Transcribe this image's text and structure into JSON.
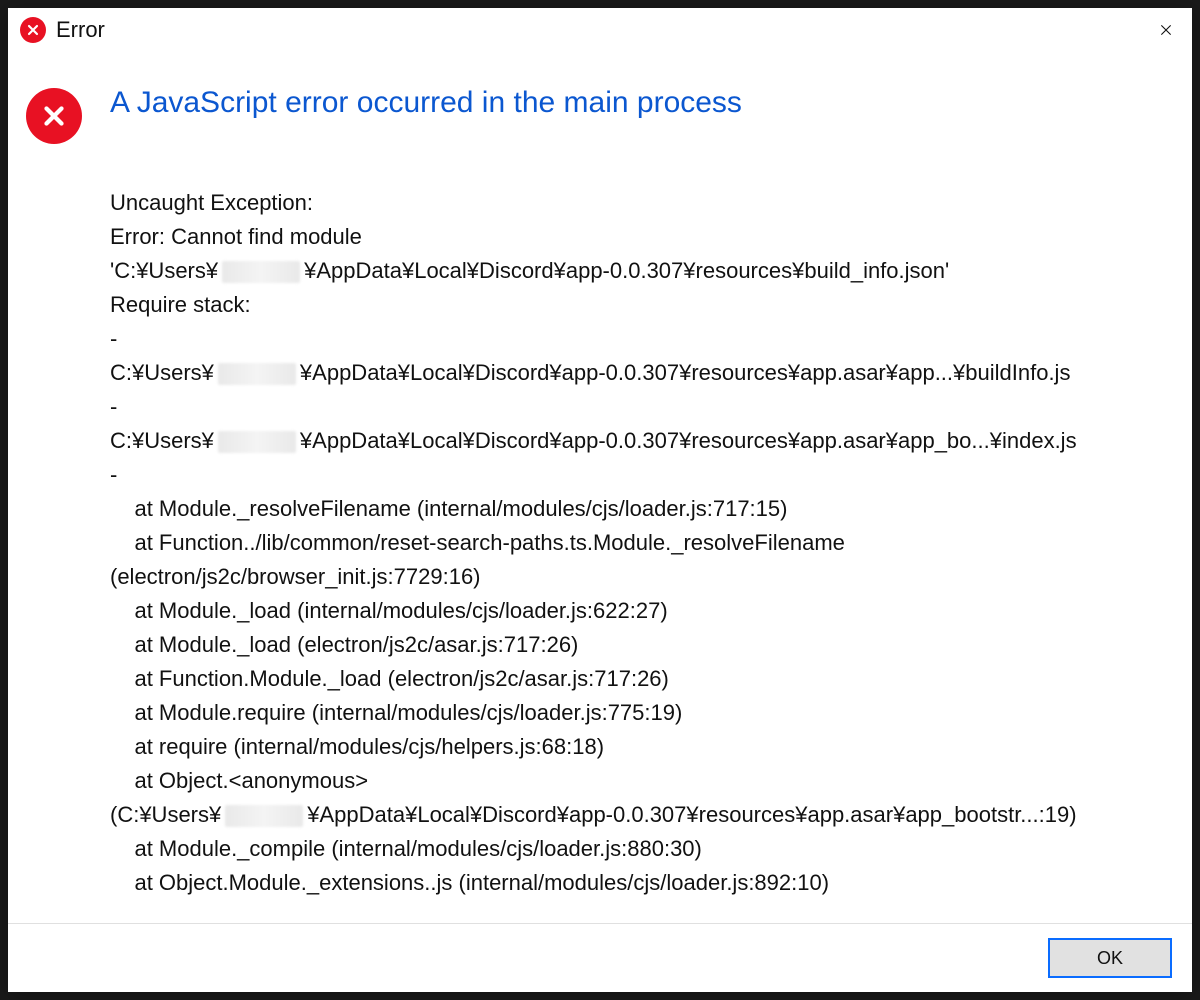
{
  "title": "Error",
  "close_label": "Close",
  "heading": "A JavaScript error occurred in the main process",
  "redacted": "[redacted]",
  "msg": {
    "l1": "Uncaught Exception:",
    "l2": "Error: Cannot find module",
    "l3a": "'C:¥Users¥",
    "l3b": "¥AppData¥Local¥Discord¥app-0.0.307¥resources¥build_info.json'",
    "l4": "Require stack:",
    "l5": "-",
    "l6a": "C:¥Users¥",
    "l6b": "¥AppData¥Local¥Discord¥app-0.0.307¥resources¥app.asar¥app...¥buildInfo.js",
    "l7": "-",
    "l8a": "C:¥Users¥",
    "l8b": "¥AppData¥Local¥Discord¥app-0.0.307¥resources¥app.asar¥app_bo...¥index.js",
    "l9": "-",
    "l10": "    at Module._resolveFilename (internal/modules/cjs/loader.js:717:15)",
    "l11": "    at Function../lib/common/reset-search-paths.ts.Module._resolveFilename",
    "l12": "(electron/js2c/browser_init.js:7729:16)",
    "l13": "    at Module._load (internal/modules/cjs/loader.js:622:27)",
    "l14": "    at Module._load (electron/js2c/asar.js:717:26)",
    "l15": "    at Function.Module._load (electron/js2c/asar.js:717:26)",
    "l16": "    at Module.require (internal/modules/cjs/loader.js:775:19)",
    "l17": "    at require (internal/modules/cjs/helpers.js:68:18)",
    "l18": "    at Object.<anonymous>",
    "l19a": "(C:¥Users¥",
    "l19b": "¥AppData¥Local¥Discord¥app-0.0.307¥resources¥app.asar¥app_bootstr...:19)",
    "l20": "    at Module._compile (internal/modules/cjs/loader.js:880:30)",
    "l21": "    at Object.Module._extensions..js (internal/modules/cjs/loader.js:892:10)"
  },
  "ok_label": "OK"
}
